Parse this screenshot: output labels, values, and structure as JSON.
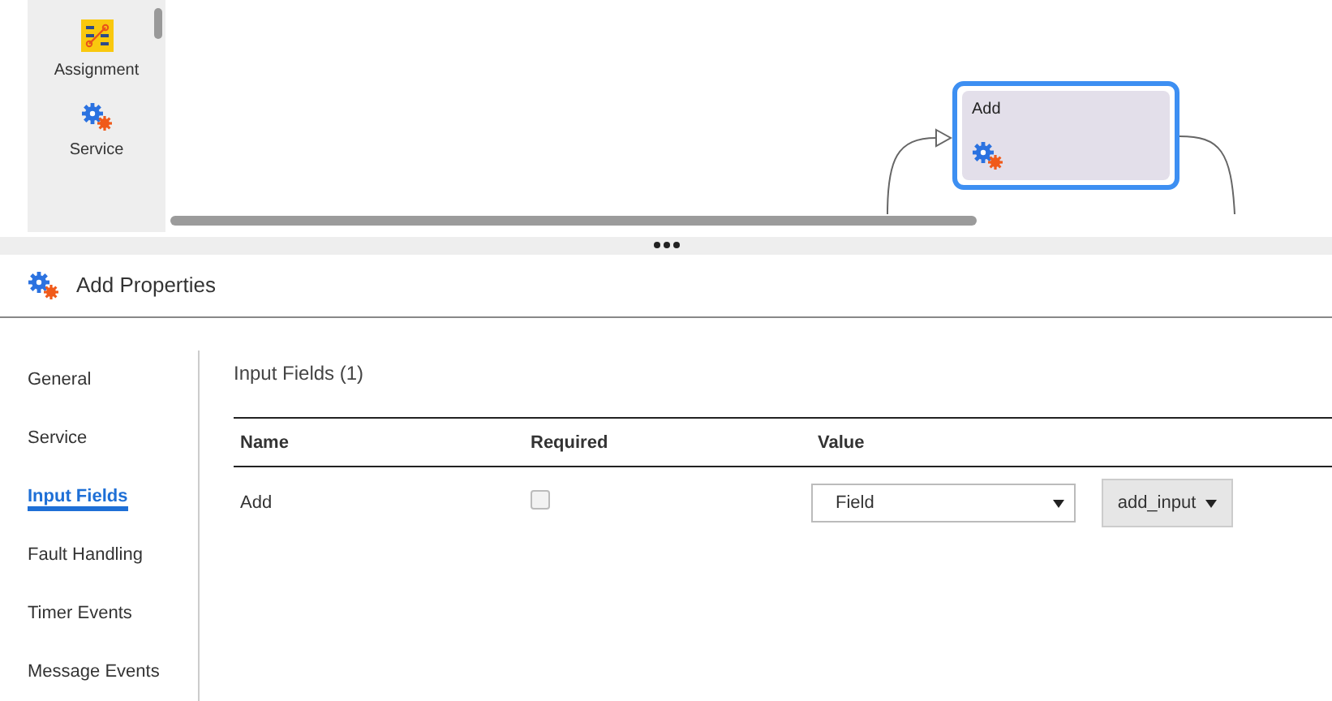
{
  "palette": {
    "items": [
      {
        "label": "Assignment",
        "kind": "assignment"
      },
      {
        "label": "Service",
        "kind": "service"
      }
    ]
  },
  "canvas": {
    "node": {
      "title": "Add",
      "selected": true
    }
  },
  "properties": {
    "title": "Add Properties",
    "nav": [
      {
        "label": "General",
        "selected": false
      },
      {
        "label": "Service",
        "selected": false
      },
      {
        "label": "Input Fields",
        "selected": true
      },
      {
        "label": "Fault Handling",
        "selected": false
      },
      {
        "label": "Timer Events",
        "selected": false
      },
      {
        "label": "Message Events",
        "selected": false
      }
    ],
    "section_title": "Input Fields (1)",
    "table": {
      "columns": [
        "Name",
        "Required",
        "Value"
      ],
      "rows": [
        {
          "name": "Add",
          "required": false,
          "value_type": "Field",
          "value": "add_input"
        }
      ]
    }
  }
}
